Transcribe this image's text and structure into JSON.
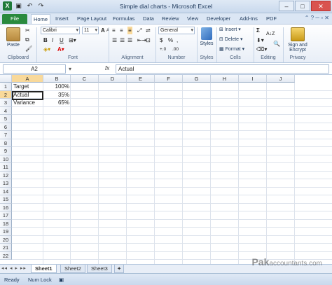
{
  "window": {
    "title": "Simple dial charts - Microsoft Excel",
    "qat": [
      "excel-logo-icon",
      "save-icon",
      "undo-icon",
      "redo-icon"
    ]
  },
  "tabs": [
    "File",
    "Home",
    "Insert",
    "Page Layout",
    "Formulas",
    "Data",
    "Review",
    "View",
    "Developer",
    "Add-Ins",
    "PDF"
  ],
  "ribbon": {
    "clipboard": {
      "label": "Clipboard",
      "paste": "Paste"
    },
    "font": {
      "label": "Font",
      "name": "Calibri",
      "size": "11",
      "bold": "B",
      "italic": "I",
      "underline": "U",
      "grow": "A",
      "shrink": "A"
    },
    "alignment": {
      "label": "Alignment"
    },
    "number": {
      "label": "Number",
      "format": "General",
      "currency": "$",
      "percent": "%",
      "comma": ",",
      "inc": "+.0",
      "dec": ".00"
    },
    "styles": {
      "label": "Styles",
      "button": "Styles"
    },
    "cells": {
      "label": "Cells",
      "insert": "Insert",
      "delete": "Delete",
      "format": "Format"
    },
    "editing": {
      "label": "Editing",
      "sum": "Σ",
      "sort": "A↓Z"
    },
    "privacy": {
      "label": "Privacy",
      "sign": "Sign and",
      "encrypt": "Encrypt"
    }
  },
  "formula_bar": {
    "namebox": "A2",
    "fx": "fx",
    "value": "Actual"
  },
  "columns": [
    "A",
    "B",
    "C",
    "D",
    "E",
    "F",
    "G",
    "H",
    "I",
    "J"
  ],
  "rows": [
    "1",
    "2",
    "3",
    "4",
    "5",
    "6",
    "7",
    "8",
    "9",
    "10",
    "11",
    "12",
    "13",
    "14",
    "15",
    "16",
    "17",
    "18",
    "19",
    "20",
    "21",
    "22"
  ],
  "cells": [
    {
      "ref": "A1",
      "text": "Target"
    },
    {
      "ref": "B1",
      "text": "100%"
    },
    {
      "ref": "A2",
      "text": "Actual"
    },
    {
      "ref": "B2",
      "text": "35%"
    },
    {
      "ref": "A3",
      "text": "Variance"
    },
    {
      "ref": "B3",
      "text": "65%"
    }
  ],
  "sheets": [
    "Sheet1",
    "Sheet2",
    "Sheet3"
  ],
  "status": {
    "ready": "Ready",
    "numlock": "Num Lock"
  },
  "watermark": {
    "brand": "Pak",
    "rest": "accountants.com"
  }
}
